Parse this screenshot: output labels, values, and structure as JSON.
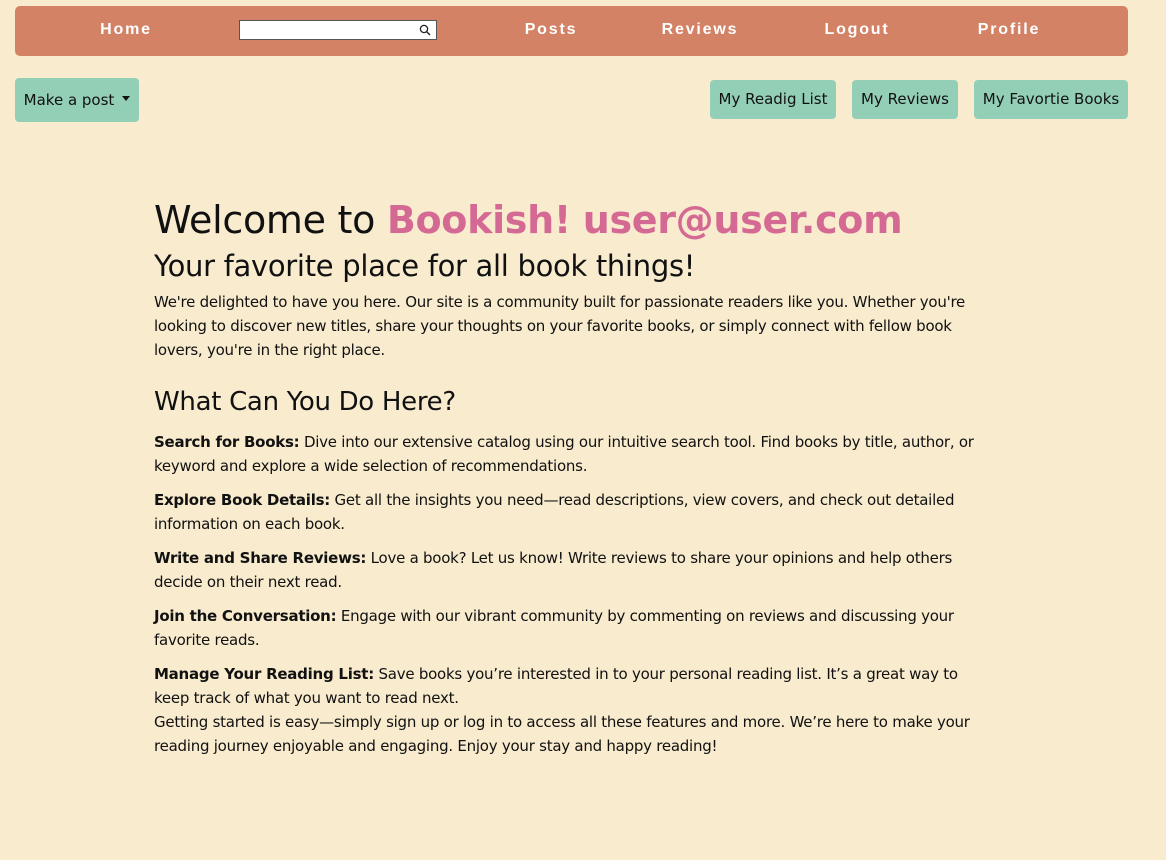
{
  "nav": {
    "home": "Home",
    "search_value": "",
    "posts": "Posts",
    "reviews": "Reviews",
    "logout": "Logout",
    "profile": "Profile"
  },
  "actions": {
    "make_post": "Make a post",
    "reading_list": "My Readig List",
    "my_reviews": "My Reviews",
    "favorite_books": "My Favortie Books"
  },
  "welcome": {
    "prefix": "Welcome to ",
    "brand": "Bookish!",
    "user": "user@user.com",
    "tagline": "Your favorite place for all book things!",
    "intro": "We're delighted to have you here. Our site is a community built for passionate readers like you. Whether you're looking to discover new titles, share your thoughts on your favorite books, or simply connect with fellow book lovers, you're in the right place."
  },
  "features": {
    "heading": "What Can You Do Here?",
    "items": [
      {
        "title": "Search for Books:",
        "text": " Dive into our extensive catalog using our intuitive search tool. Find books by title, author, or keyword and explore a wide selection of recommendations."
      },
      {
        "title": "Explore Book Details:",
        "text": " Get all the insights you need—read descriptions, view covers, and check out detailed information on each book."
      },
      {
        "title": "Write and Share Reviews:",
        "text": " Love a book? Let us know! Write reviews to share your opinions and help others decide on their next read."
      },
      {
        "title": "Join the Conversation:",
        "text": " Engage with our vibrant community by commenting on reviews and discussing your favorite reads."
      },
      {
        "title": "Manage Your Reading List:",
        "text": " Save books you’re interested in to your personal reading list. It’s a great way to keep track of what you want to read next."
      }
    ],
    "closing": "Getting started is easy—simply sign up or log in to access all these features and more. We’re here to make your reading journey enjoyable and engaging. Enjoy your stay and happy reading!"
  },
  "colors": {
    "background": "#f8ebce",
    "navbar": "#d48266",
    "button": "#93cfb7",
    "accent": "#d46a93"
  },
  "icons": {
    "search": "search-icon",
    "dropdown": "caret-down-icon"
  }
}
